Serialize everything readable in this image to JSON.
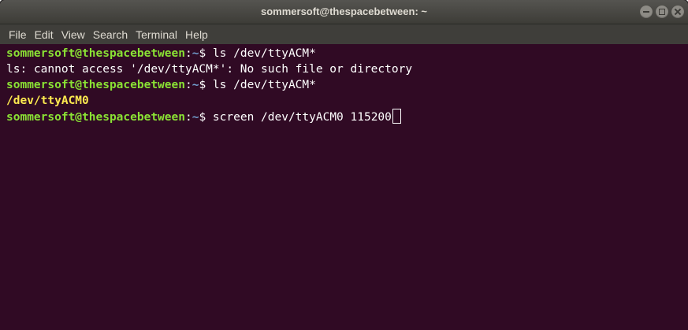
{
  "window": {
    "title": "sommersoft@thespacebetween: ~",
    "controls": {
      "minimize_icon": "minimize-icon",
      "maximize_icon": "maximize-icon",
      "close_icon": "close-icon"
    }
  },
  "menubar": {
    "items": [
      "File",
      "Edit",
      "View",
      "Search",
      "Terminal",
      "Help"
    ]
  },
  "terminal": {
    "colors": {
      "background": "#300a24",
      "user": "#8ae234",
      "path": "#729fcf",
      "text": "#ffffff",
      "highlight": "#fce94f"
    },
    "lines": [
      {
        "type": "prompt",
        "user": "sommersoft@thespacebetween",
        "sep": ":",
        "path": "~",
        "symbol": "$ ",
        "command": "ls /dev/ttyACM*"
      },
      {
        "type": "output",
        "text": "ls: cannot access '/dev/ttyACM*': No such file or directory"
      },
      {
        "type": "prompt",
        "user": "sommersoft@thespacebetween",
        "sep": ":",
        "path": "~",
        "symbol": "$ ",
        "command": "ls /dev/ttyACM*"
      },
      {
        "type": "output_highlight",
        "text": "/dev/ttyACM0"
      },
      {
        "type": "prompt",
        "user": "sommersoft@thespacebetween",
        "sep": ":",
        "path": "~",
        "symbol": "$ ",
        "command": "screen /dev/ttyACM0 115200"
      }
    ]
  }
}
